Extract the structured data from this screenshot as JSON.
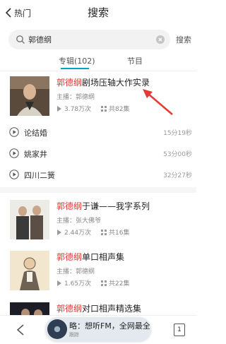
{
  "header": {
    "back_label": "热门",
    "title": "搜索"
  },
  "search": {
    "query": "郭德纲",
    "button_label": "搜索"
  },
  "tabs": [
    {
      "label": "专辑(102)",
      "active": true
    },
    {
      "label": "节目",
      "active": false
    }
  ],
  "albums": [
    {
      "title_highlight": "郭德纲",
      "title_rest": "剧场压轴大作实录",
      "host": "主播：郭德纲",
      "plays": "3.78万次",
      "episodes": "共82集",
      "tracks": [
        {
          "name": "论结婚",
          "duration": "15分19秒"
        },
        {
          "name": "姚家井",
          "duration": "53分00秒"
        },
        {
          "name": "四川二簧",
          "duration": "32分27秒"
        }
      ]
    },
    {
      "title_highlight": "郭德纲",
      "title_rest": "于谦——我字系列",
      "host": "主播：张大佛爷",
      "plays": "2.44万次",
      "episodes": "共16集"
    },
    {
      "title_highlight": "郭德纲",
      "title_rest": "单口相声集",
      "host": "主播：郭德纲",
      "plays": "1.65万次",
      "episodes": "共22集"
    },
    {
      "title_highlight": "郭德纲",
      "title_rest": "对口相声精选集"
    }
  ],
  "player": {
    "marquee": "略：想听FM，全网最全",
    "sub": "跟踪"
  },
  "pager": {
    "page": "1"
  },
  "colors": {
    "accent": "#00a6c0",
    "highlight": "#e53935",
    "annotation_arrow": "#e53935"
  }
}
